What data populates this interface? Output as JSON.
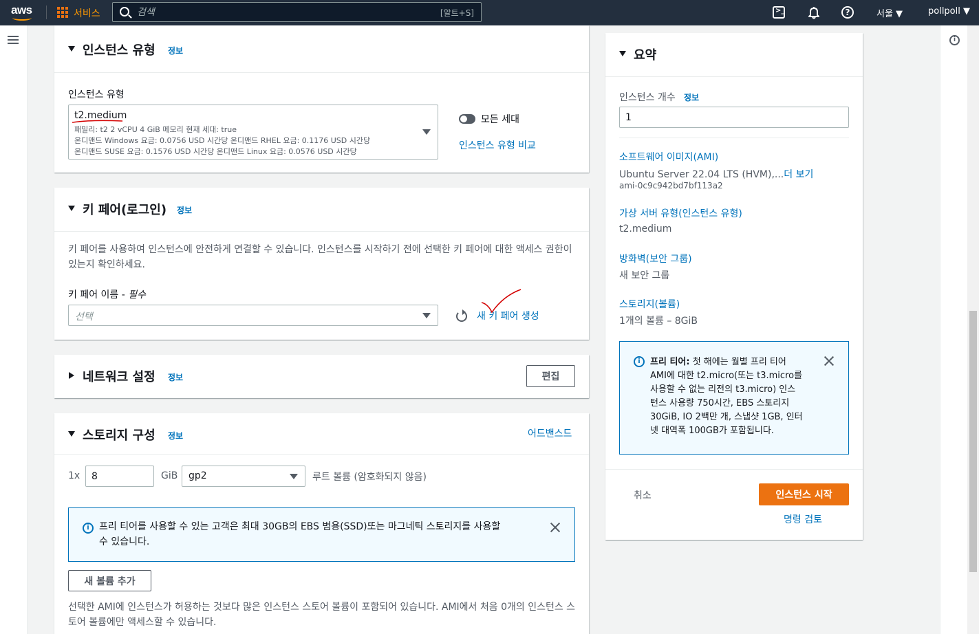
{
  "nav": {
    "logo": "aws",
    "services": "서비스",
    "search_placeholder": "검색",
    "search_shortcut": "[알트+S]",
    "help_icon_glyph": "?",
    "region": "서울 ▼",
    "user": "pollpoll ▼"
  },
  "instance_type_panel": {
    "title": "인스턴스 유형",
    "info": "정보",
    "field_label": "인스턴스 유형",
    "selected": "t2.medium",
    "line1": "패밀리: t2    2 vCPU    4 GiB 메모리    현재 세대: true",
    "line2": "온디맨드 Windows 요금: 0.0756 USD 시간당    온디맨드 RHEL 요금: 0.1176 USD 시간당",
    "line3": "온디맨드 SUSE 요금: 0.1576 USD 시간당    온디맨드 Linux 요금: 0.0576 USD 시간당",
    "all_generations": "모든 세대",
    "compare_link": "인스턴스 유형 비교"
  },
  "keypair_panel": {
    "title": "키 페어(로그인)",
    "info": "정보",
    "description": "키 페어를 사용하여 인스턴스에 안전하게 연결할 수 있습니다. 인스턴스를 시작하기 전에 선택한 키 페어에 대한 액세스 권한이 있는지 확인하세요.",
    "field_label": "키 페어 이름 - ",
    "required": "필수",
    "select_placeholder": "선택",
    "create_link": "새 키 페어 생성"
  },
  "network_panel": {
    "title": "네트워크 설정",
    "info": "정보",
    "edit_button": "편집"
  },
  "storage_panel": {
    "title": "스토리지 구성",
    "info": "정보",
    "advanced_link": "어드밴스드",
    "count_prefix": "1x",
    "size_value": "8",
    "unit": "GiB",
    "volume_type": "gp2",
    "root_volume": "루트 볼륨  (암호화되지 않음)",
    "alert_text": "프리 티어를 사용할 수 있는 고객은 최대 30GB의 EBS 범용(SSD)또는 마그네틱 스토리지를 사용할 수 있습니다.",
    "add_volume_button": "새 볼륨 추가",
    "footer_text": "선택한 AMI에 인스턴스가 허용하는 것보다 많은 인스턴스 스토어 볼륨이 포함되어 있습니다. AMI에서 처음 0개의 인스턴스 스토어 볼륨에만 액세스할 수 있습니다."
  },
  "summary_panel": {
    "title": "요약",
    "instance_count_label": "인스턴스 개수",
    "info": "정보",
    "instance_count_value": "1",
    "ami_link": "소프트웨어 이미지(AMI)",
    "ami_name": "Ubuntu Server 22.04 LTS (HVM),...",
    "ami_more": "더 보기",
    "ami_id": "ami-0c9c942bd7bf113a2",
    "instance_type_link": "가상 서버 유형(인스턴스 유형)",
    "instance_type_value": "t2.medium",
    "firewall_link": "방화벽(보안 그룹)",
    "firewall_value": "새 보안 그룹",
    "storage_link": "스토리지(볼륨)",
    "storage_value": "1개의 볼륨 – 8GiB",
    "free_tier_bold": "프리 티어:",
    "free_tier_line1": " 첫 해에는 월별 프리 티어",
    "free_tier_line2": "AMI에 대한 t2.micro(또는 t3.micro를",
    "free_tier_line3": "사용할 수 없는 리전의 t3.micro) 인스",
    "free_tier_line4": "턴스 사용량 750시간, EBS 스토리지",
    "free_tier_line5": "30GiB, IO 2백만 개, 스냅샷 1GB, 인터",
    "free_tier_line6": "넷 대역폭 100GB가 포함됩니다.",
    "cancel": "취소",
    "launch_button": "인스턴스 시작",
    "review_link": "명령 검토"
  },
  "colors": {
    "nav_bg": "#232f3e",
    "accent_orange": "#ec7211",
    "link_blue": "#0073bb",
    "annotation_red": "#d40000"
  }
}
